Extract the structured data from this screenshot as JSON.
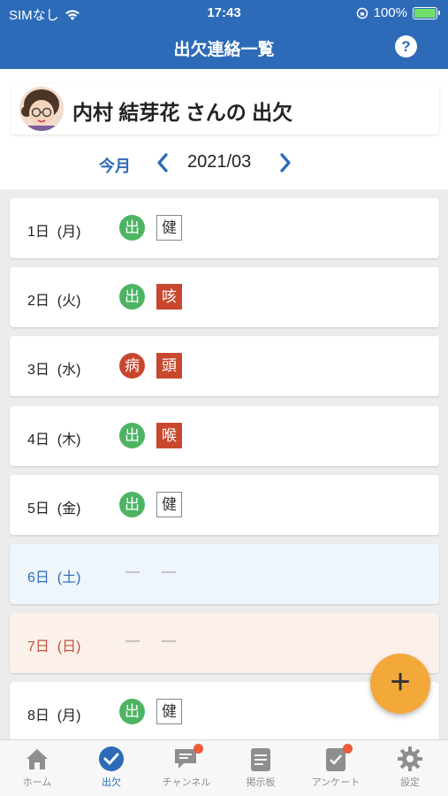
{
  "status_bar": {
    "carrier": "SIMなし",
    "time": "17:43",
    "battery": "100%"
  },
  "header": {
    "title": "出欠連絡一覧",
    "help": "?"
  },
  "student": {
    "name": "内村 結芽花 さんの 出欠"
  },
  "month_nav": {
    "today": "今月",
    "month": "2021/03"
  },
  "days": [
    {
      "date": "1日  (月)",
      "attendance": "出",
      "health": "健",
      "type": "weekday",
      "attendance_status": "present",
      "health_status": "healthy"
    },
    {
      "date": "2日  (火)",
      "attendance": "出",
      "health": "咳",
      "type": "weekday",
      "attendance_status": "present",
      "health_status": "symptom"
    },
    {
      "date": "3日  (水)",
      "attendance": "病",
      "health": "頭",
      "type": "weekday",
      "attendance_status": "sick",
      "health_status": "symptom"
    },
    {
      "date": "4日  (木)",
      "attendance": "出",
      "health": "喉",
      "type": "weekday",
      "attendance_status": "present",
      "health_status": "symptom"
    },
    {
      "date": "5日  (金)",
      "attendance": "出",
      "health": "健",
      "type": "weekday",
      "attendance_status": "present",
      "health_status": "healthy"
    },
    {
      "date": "6日  (土)",
      "attendance": "—",
      "health": "—",
      "type": "saturday"
    },
    {
      "date": "7日  (日)",
      "attendance": "—",
      "health": "—",
      "type": "sunday"
    },
    {
      "date": "8日  (月)",
      "attendance": "出",
      "health": "健",
      "type": "weekday",
      "attendance_status": "present",
      "health_status": "healthy"
    }
  ],
  "fab": {
    "label": "+"
  },
  "tabs": [
    {
      "label": "ホーム",
      "icon": "home-icon",
      "active": false
    },
    {
      "label": "出欠",
      "icon": "check-circle-icon",
      "active": true
    },
    {
      "label": "チャンネル",
      "icon": "chat-icon",
      "active": false,
      "badge": true
    },
    {
      "label": "掲示板",
      "icon": "board-icon",
      "active": false
    },
    {
      "label": "アンケート",
      "icon": "survey-icon",
      "active": false,
      "badge": true
    },
    {
      "label": "設定",
      "icon": "gear-icon",
      "active": false
    }
  ],
  "colors": {
    "primary": "#2d6bb8",
    "present": "#4cb463",
    "sick": "#c8482f",
    "fab": "#f2a93a",
    "saturday_bg": "#eef5fb",
    "sunday_bg": "#fbf1ea"
  }
}
